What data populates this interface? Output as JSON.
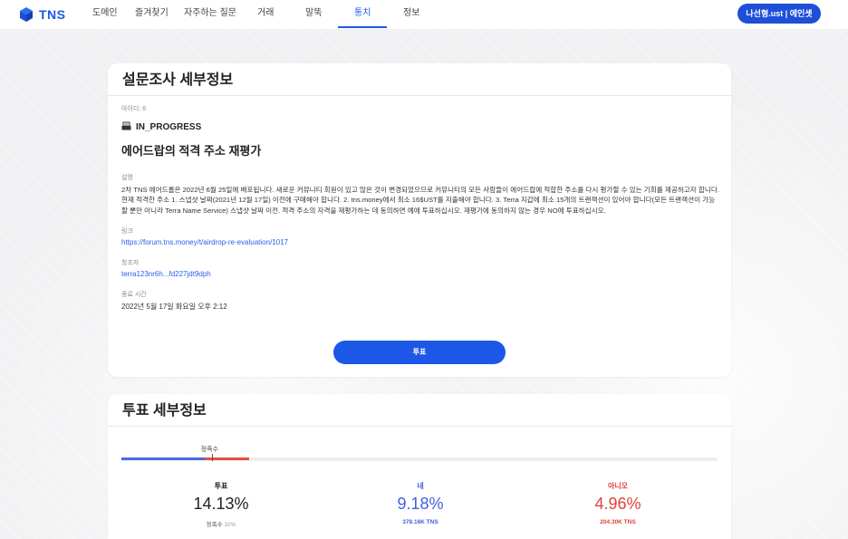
{
  "app": {
    "logo_text": "TNS",
    "brand_color": "#1d57e8"
  },
  "nav": {
    "items": [
      {
        "label": "도메인",
        "active": false
      },
      {
        "label": "즐겨찾기",
        "active": false
      },
      {
        "label": "자주하는 질문",
        "active": false
      },
      {
        "label": "거래",
        "active": false
      },
      {
        "label": "말뚝",
        "active": false
      },
      {
        "label": "통치",
        "active": true
      },
      {
        "label": "정보",
        "active": false
      }
    ],
    "user_button": "나선형.ust | 에인셋"
  },
  "survey": {
    "header": "설문조사 세부정보",
    "id_label": "아이디: 6",
    "status_icon": "ballot-box-icon",
    "status": "IN_PROGRESS",
    "title": "에어드랍의 적격 주소 재평가",
    "description_label": "설명",
    "description": "2차 TNS 에어드롭은 2022년 6월 25일에 배포됩니다. 새로운 커뮤니티 회원이 있고 많은 것이 변경되었으므로 커뮤니티의 모든 사람들이 에어드랍에 적합한 주소를 다시 평가할 수 있는 기회를 제공하고자 합니다. 현재 적격한 주소 1. 스냅샷 날짜(2021년 12월 17일) 이전에 구매해야 합니다. 2. tns.money에서 최소 16$UST를 지출해야 합니다. 3. Terra 지갑에 최소 15개의 트랜잭션이 있어야 합니다(모든 트랜잭션이 가능할 뿐만 아니라 Terra Name Service) 스냅샷 날짜 이전. 적격 주소의 자격을 재평가하는 데 동의하면 예에 투표하십시오. 재평가에 동의하지 않는 경우 NO에 투표하십시오.",
    "link_label": "링크",
    "link": "https://forum.tns.money/t/airdrop-re-evaluation/1017",
    "creator_label": "창조자",
    "creator": "terra123nr6h...fd227jdt9dph",
    "end_time_label": "종료 시간",
    "end_time": "2022년 5월 17일 화요일 오후 2:12",
    "vote_button": "투표"
  },
  "vote": {
    "header": "투표 세부정보",
    "quorum_label": "정족수",
    "quorum_fraction": 0.1,
    "yes_fraction": 0.0918,
    "no_fraction": 0.0496,
    "stats": [
      {
        "label": "투표",
        "value": "14.13%",
        "sub_label": "정족수",
        "sub_value": "10%",
        "color": "#222222"
      },
      {
        "label": "네",
        "value": "9.18%",
        "sub_value": "378.16K TNS",
        "color": "#3f5fe0"
      },
      {
        "label": "아니오",
        "value": "4.96%",
        "sub_value": "204.30K TNS",
        "color": "#e0413a"
      }
    ]
  }
}
